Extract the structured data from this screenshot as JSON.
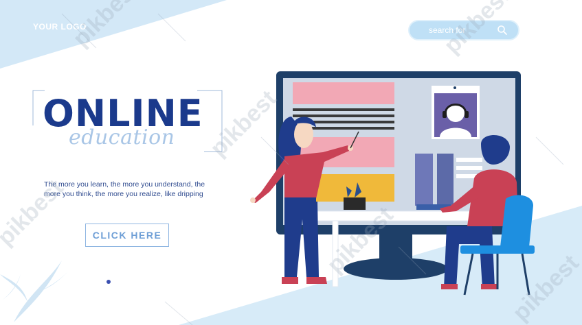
{
  "header": {
    "logo": "YOUR LOGO"
  },
  "search": {
    "placeholder": "search for",
    "icon": "search-icon"
  },
  "hero": {
    "title": "ONLINE",
    "subtitle": "education",
    "description_line1": "The more you learn, the more you understand, the",
    "description_line2": "more you think, the more you realize, like dripping"
  },
  "cta": {
    "label": "CLICK HERE"
  },
  "watermark": {
    "text": "pikbest"
  },
  "colors": {
    "primary": "#1b3a8c",
    "accent_light": "#a9c6e6",
    "search_bg": "#bfe0f6",
    "background_wedge": "#d7ebf8"
  }
}
